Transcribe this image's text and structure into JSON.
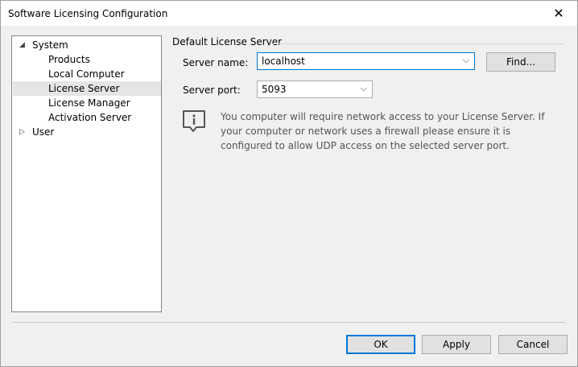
{
  "window": {
    "title": "Software Licensing Configuration"
  },
  "tree": {
    "items": [
      {
        "label": "System",
        "expanded": true
      },
      {
        "label": "Products"
      },
      {
        "label": "Local Computer"
      },
      {
        "label": "License Server",
        "selected": true
      },
      {
        "label": "License Manager"
      },
      {
        "label": "Activation Server"
      },
      {
        "label": "User",
        "expanded": false
      }
    ]
  },
  "panel": {
    "group_title": "Default License Server",
    "server_name_label": "Server name:",
    "server_name_value": "localhost",
    "find_button": "Find...",
    "server_port_label": "Server port:",
    "server_port_value": "5093",
    "info_text": "You computer will require network access to your License Server. If your computer or network uses a firewall please ensure it is configured to allow UDP access on the selected server port."
  },
  "buttons": {
    "ok": "OK",
    "apply": "Apply",
    "cancel": "Cancel"
  },
  "icons": {
    "close": "close-icon",
    "info": "info-icon",
    "expand": "expand-arrow-icon",
    "collapse": "collapse-arrow-icon",
    "dropdown": "chevron-down-icon"
  }
}
